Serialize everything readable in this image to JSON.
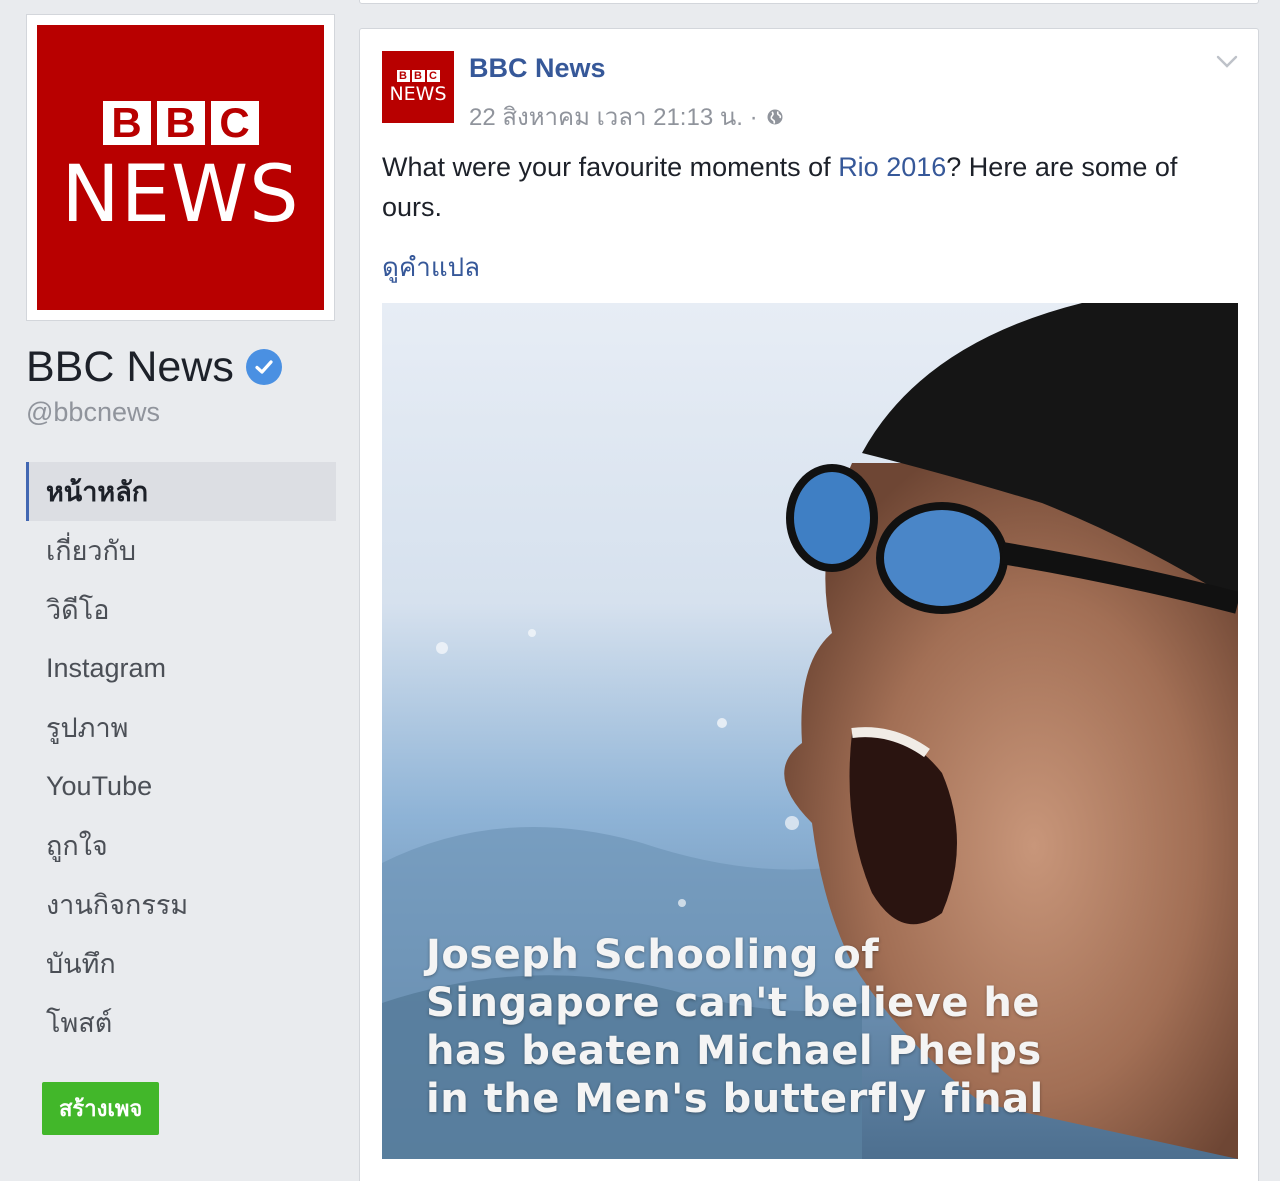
{
  "page": {
    "logo_letters": [
      "B",
      "B",
      "C"
    ],
    "logo_word": "NEWS",
    "name": "BBC News",
    "handle": "@bbcnews"
  },
  "nav": {
    "items": [
      {
        "label": "หน้าหลัก",
        "active": true
      },
      {
        "label": "เกี่ยวกับ"
      },
      {
        "label": "วิดีโอ"
      },
      {
        "label": "Instagram"
      },
      {
        "label": "รูปภาพ"
      },
      {
        "label": "YouTube"
      },
      {
        "label": "ถูกใจ"
      },
      {
        "label": "งานกิจกรรม"
      },
      {
        "label": "บันทึก"
      },
      {
        "label": "โพสต์"
      }
    ],
    "create_page_label": "สร้างเพจ"
  },
  "post": {
    "avatar_letters": [
      "B",
      "B",
      "C"
    ],
    "avatar_word": "NEWS",
    "author": "BBC News",
    "timestamp": "22 สิงหาคม เวลา 21:13 น. ·",
    "text_before_link": "What were your favourite moments of ",
    "link_text": "Rio 2016",
    "text_after_link": "? Here are some of ours.",
    "see_translation": "ดูคำแปล",
    "video_caption": "Joseph Schooling of Singapore can't believe he has beaten Michael Phelps in the Men's butterfly final"
  },
  "colors": {
    "bbc_red": "#b80000",
    "link_blue": "#365899",
    "verified_blue": "#4a90e2",
    "create_green": "#42b72a"
  },
  "icons": [
    "verified-badge-icon",
    "globe-icon",
    "chevron-down-icon"
  ]
}
